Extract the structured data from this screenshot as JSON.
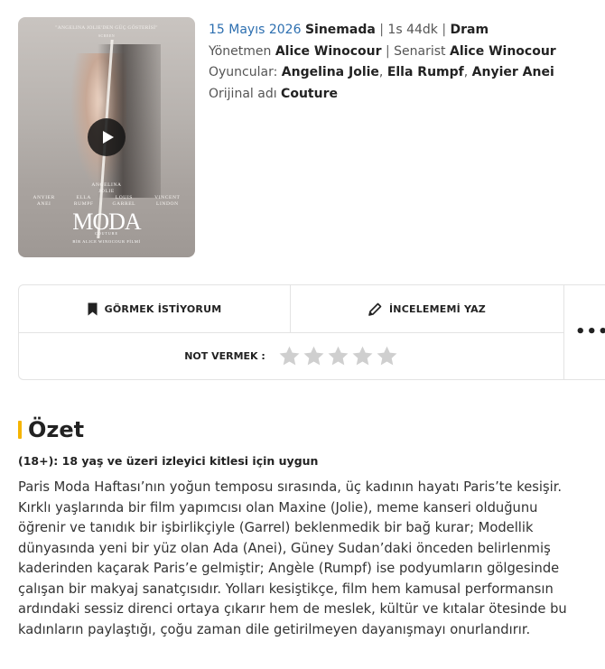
{
  "poster": {
    "tagline": "\"ANGELINA JOLIE'DEN GÜÇ GÖSTERİSİ\"",
    "tagline_source": "SCREEN",
    "lead": "ANGELINA\nJOLIE",
    "cast": [
      "ANYIER\nANEI",
      "ELLA\nRUMPF",
      "LOUIS\nGARREL",
      "VINCENT\nLINDON"
    ],
    "title": "MODA",
    "subtitle": "COUTURE",
    "bottom_line": "BİR ALICE WINOCOUR FİLMİ"
  },
  "meta": {
    "release_date": "15 Mayıs 2026",
    "release_status": "Sinemada",
    "duration": "1s 44dk",
    "genre": "Dram",
    "director_label": "Yönetmen",
    "director": "Alice Winocour",
    "writer_label": "Senarist",
    "writer": "Alice Winocour",
    "cast_label": "Oyuncular:",
    "cast": [
      "Angelina Jolie",
      "Ella Rumpf",
      "Anyier Anei"
    ],
    "original_title_label": "Orijinal adı",
    "original_title": "Couture"
  },
  "actions": {
    "watchlist_label": "GÖRMEK İSTİYORUM",
    "review_label": "İNCELEMEMİ YAZ",
    "more_label": "•••",
    "rate_label": "NOT VERMEK :",
    "stars": 5,
    "rating": 0
  },
  "summary": {
    "heading": "Özet",
    "age_rating": "(18+): 18 yaş ve üzeri izleyici kitlesi için uygun",
    "text": "Paris Moda Haftası’nın yoğun temposu sırasında, üç kadının hayatı Paris’te kesişir. Kırklı yaşlarında bir film yapımcısı olan Maxine (Jolie), meme kanseri olduğunu öğrenir ve tanıdık bir işbirlikçiyle (Garrel) beklenmedik bir bağ kurar; Modellik dünyasında yeni bir yüz olan Ada (Anei), Güney Sudan’daki önceden belirlenmiş kaderinden kaçarak Paris’e gelmiştir; Angèle (Rumpf) ise podyumların gölgesinde çalışan bir makyaj sanatçısıdır. Yolları kesiştikçe, film hem kamusal performansın ardındaki sessiz direnci ortaya çıkarır hem de meslek, kültür ve kıtalar ötesinde bu kadınların paylaştığı, çoğu zaman dile getirilmeyen dayanışmayı onurlandırır."
  },
  "colors": {
    "accent": "#f5b400",
    "date_link": "#2d6fb0",
    "star_empty": "#cfcfcf"
  }
}
